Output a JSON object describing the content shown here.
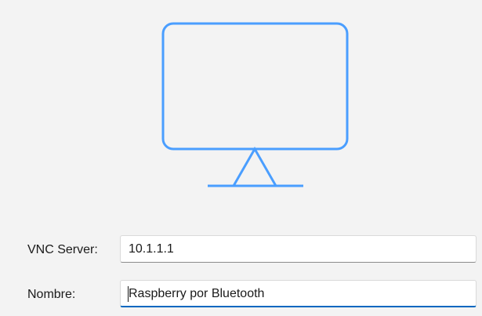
{
  "icon": {
    "name": "monitor-icon",
    "color": "#4a9eff"
  },
  "form": {
    "server": {
      "label": "VNC Server:",
      "value": "10.1.1.1"
    },
    "name": {
      "label": "Nombre:",
      "value": "Raspberry por Bluetooth"
    }
  },
  "colors": {
    "background": "#f3f3f3",
    "focus_accent": "#0067c0"
  }
}
